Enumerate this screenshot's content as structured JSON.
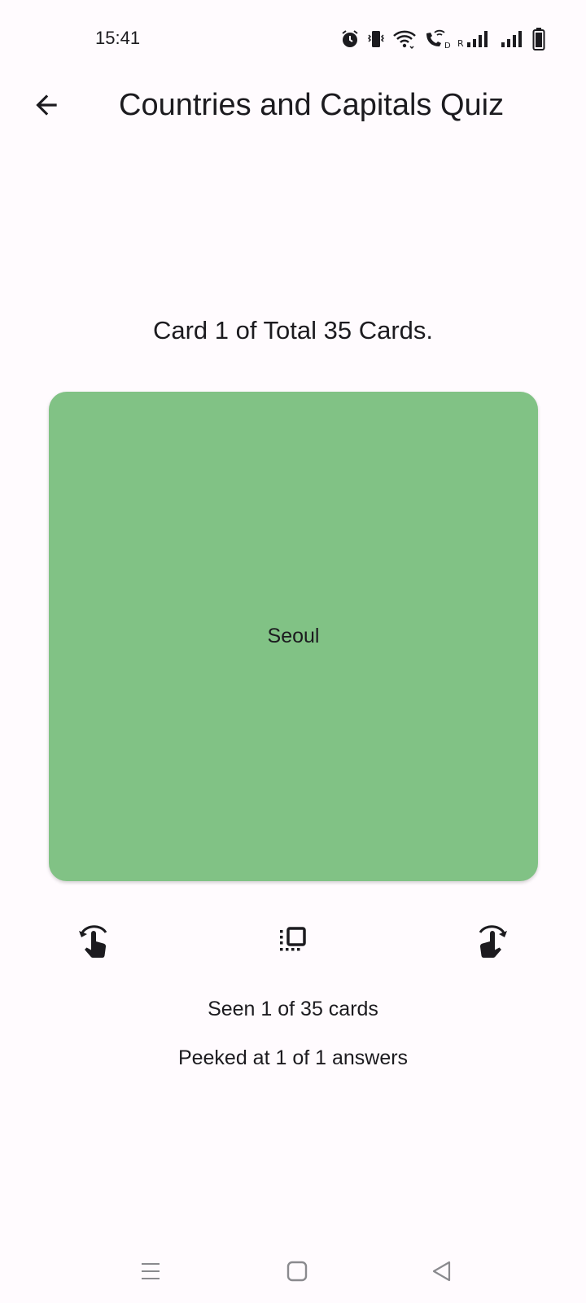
{
  "status_bar": {
    "time": "15:41",
    "icons": [
      "alarm-icon",
      "vibrate-icon",
      "wifi-icon",
      "wifi-calling-icon",
      "signal-icon",
      "signal-icon",
      "battery-icon"
    ]
  },
  "app_bar": {
    "title": "Countries and Capitals Quiz",
    "back_icon": "arrow-left-icon"
  },
  "quiz": {
    "counter": "Card 1 of Total 35 Cards.",
    "card_text": "Seoul",
    "card_color": "#81C285"
  },
  "controls": {
    "previous_icon": "swipe-left-hand-icon",
    "flip_icon": "flip-card-icon",
    "next_icon": "swipe-right-hand-icon"
  },
  "stats": {
    "seen": "Seen 1 of 35 cards",
    "peeked": "Peeked at 1 of 1 answers"
  },
  "nav_bar": {
    "menu_icon": "recents-menu-icon",
    "home_icon": "home-square-icon",
    "back_icon": "back-triangle-icon"
  }
}
